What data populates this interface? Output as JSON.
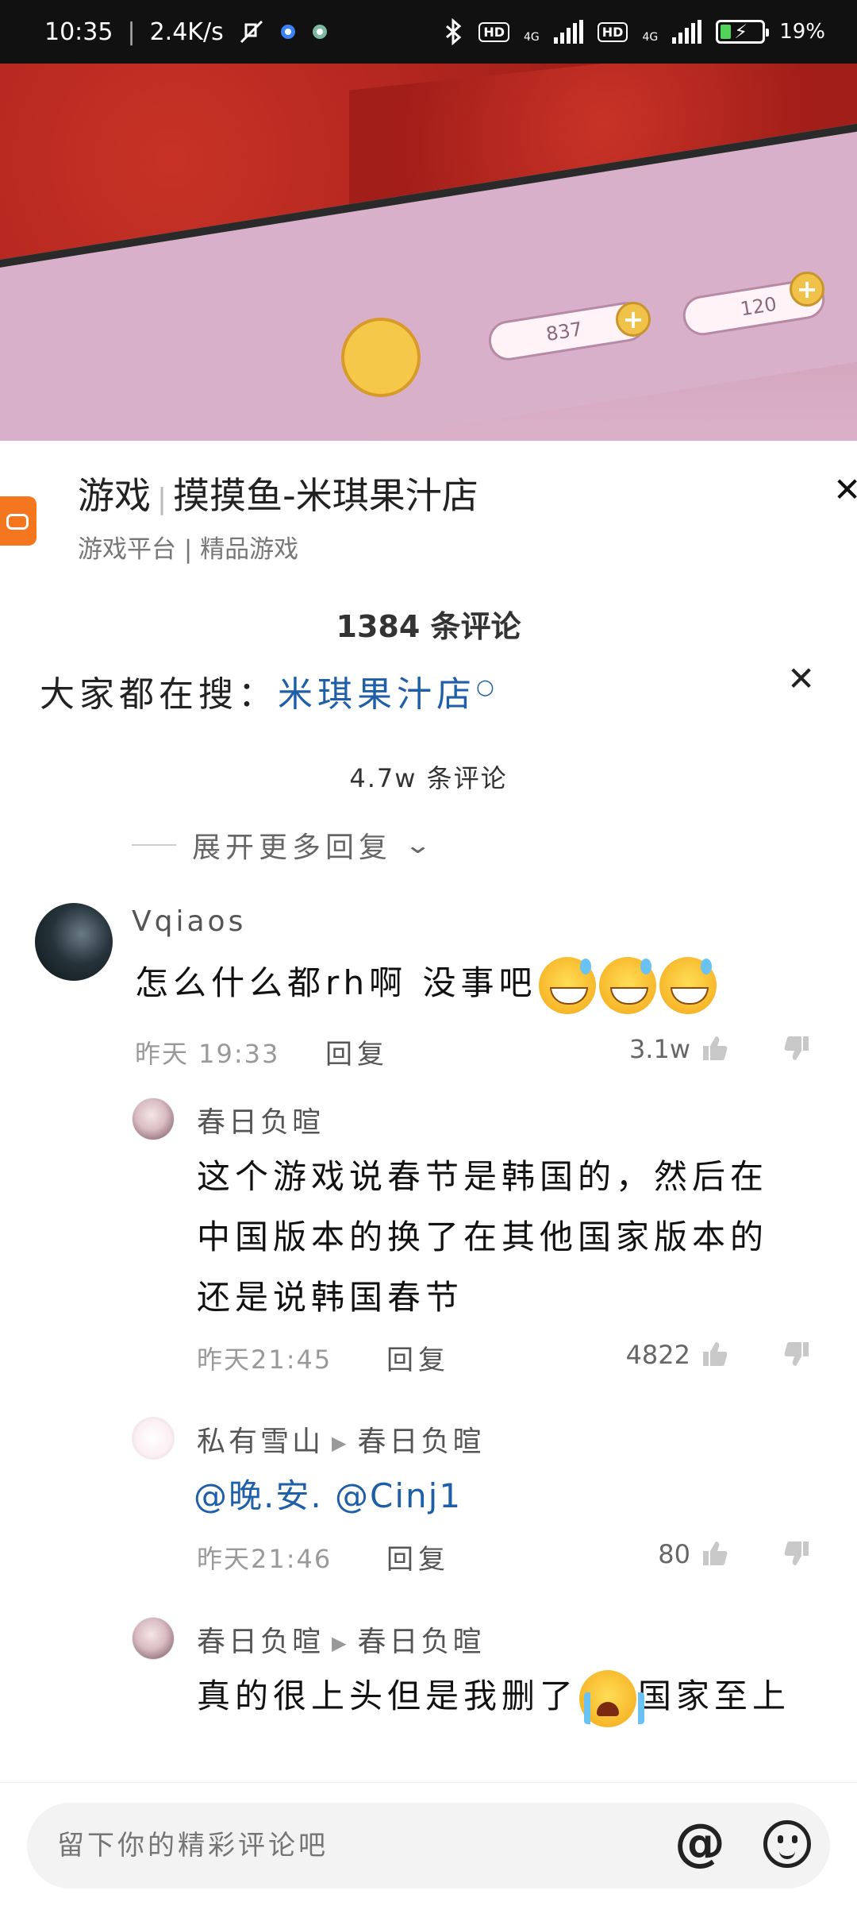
{
  "status_bar": {
    "time": "10:35",
    "speed": "2.4K/s",
    "network1": "4G",
    "network2": "4G",
    "hd": "HD",
    "battery": "19%"
  },
  "video": {
    "counter1": "837",
    "counter2": "120"
  },
  "ad": {
    "category": "游戏",
    "title": "摸摸鱼-米琪果汁店",
    "subtitle": "游戏平台 | 精品游戏"
  },
  "comments_header": {
    "count_text": "1384 条评论"
  },
  "search_hint": {
    "prefix": "大家都在搜：",
    "keyword": "米琪果汁店",
    "icon": "search-icon"
  },
  "overlay_count": {
    "text": "4.7w 条评论"
  },
  "expand_more": {
    "label": "展开更多回复"
  },
  "main_comment": {
    "username": "Vqiaos",
    "text": "怎么什么都rh啊 没事吧",
    "emojis": [
      "grin-sweat",
      "grin-sweat",
      "grin-sweat"
    ],
    "time": "昨天 19:33",
    "reply": "回复",
    "likes": "3.1w"
  },
  "replies": [
    {
      "username": "春日负暄",
      "reply_to": "",
      "text": "这个游戏说春节是韩国的，然后在中国版本的换了在其他国家版本的还是说韩国春节",
      "time": "昨天21:45",
      "reply": "回复",
      "likes": "4822"
    },
    {
      "username": "私有雪山",
      "reply_to": "春日负暄",
      "mentions": "@晚.安. @Cinj1",
      "time": "昨天21:46",
      "reply": "回复",
      "likes": "80"
    },
    {
      "username": "春日负暄",
      "reply_to": "春日负暄",
      "text_before": "真的很上头但是我删了",
      "text_after": "国家至上",
      "emoji": "crying"
    }
  ],
  "input_bar": {
    "placeholder": "留下你的精彩评论吧",
    "at_icon": "@"
  },
  "colors": {
    "link": "#1e5fa8",
    "ad_accent": "#f4761e"
  }
}
